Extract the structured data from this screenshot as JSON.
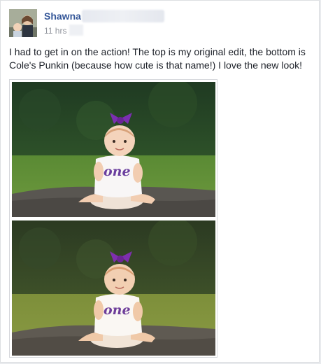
{
  "post": {
    "author_name": "Shawna",
    "timestamp": "11 hrs",
    "text": "I had to get in on the action! The top is my original edit, the bottom is Cole's Punkin (because how cute is that name!) I love the new look!"
  },
  "photos": {
    "top": {
      "onesie_text": "one"
    },
    "bottom": {
      "onesie_text": "one"
    }
  },
  "colors": {
    "link": "#365899",
    "meta": "#90949c",
    "text": "#1d2129"
  }
}
